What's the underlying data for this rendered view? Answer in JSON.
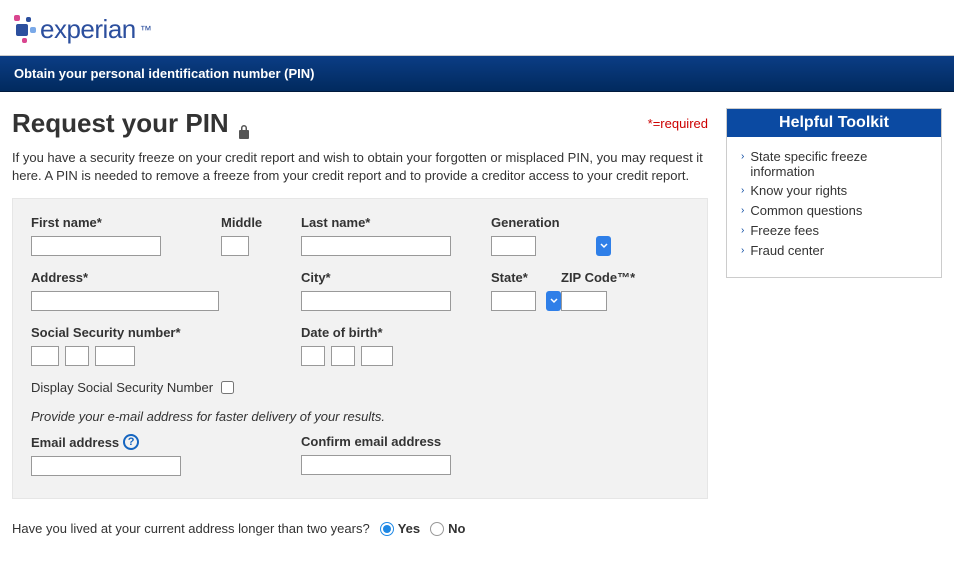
{
  "brand": {
    "name": "experian"
  },
  "header": {
    "band": "Obtain your personal identification number (PIN)"
  },
  "page": {
    "title": "Request your PIN",
    "required_note": "*=required",
    "intro": "If you have a security freeze on your credit report and wish to obtain your forgotten or misplaced PIN, you may request it here. A PIN is needed to remove a freeze from your credit report and to provide a creditor access to your credit report."
  },
  "form": {
    "first_name": {
      "label": "First name*",
      "value": ""
    },
    "middle": {
      "label": "Middle",
      "value": ""
    },
    "last_name": {
      "label": "Last name*",
      "value": ""
    },
    "generation": {
      "label": "Generation",
      "value": ""
    },
    "address": {
      "label": "Address*",
      "value": ""
    },
    "city": {
      "label": "City*",
      "value": ""
    },
    "state": {
      "label": "State*",
      "value": ""
    },
    "zip": {
      "label": "ZIP Code™*",
      "value": ""
    },
    "ssn": {
      "label": "Social Security number*",
      "p1": "",
      "p2": "",
      "p3": ""
    },
    "dob": {
      "label": "Date of birth*",
      "p1": "",
      "p2": "",
      "p3": ""
    },
    "display_ssn": {
      "label": "Display Social Security Number",
      "checked": false
    },
    "email_hint": "Provide your e-mail address for faster delivery of your results.",
    "email": {
      "label": "Email address",
      "value": ""
    },
    "confirm_email": {
      "label": "Confirm email address",
      "value": ""
    }
  },
  "question": {
    "text": "Have you lived at your current address longer than two years?",
    "yes": "Yes",
    "no": "No",
    "selected": "yes"
  },
  "sidebar": {
    "title": "Helpful Toolkit",
    "items": [
      "State specific freeze information",
      "Know your rights",
      "Common questions",
      "Freeze fees",
      "Fraud center"
    ]
  }
}
